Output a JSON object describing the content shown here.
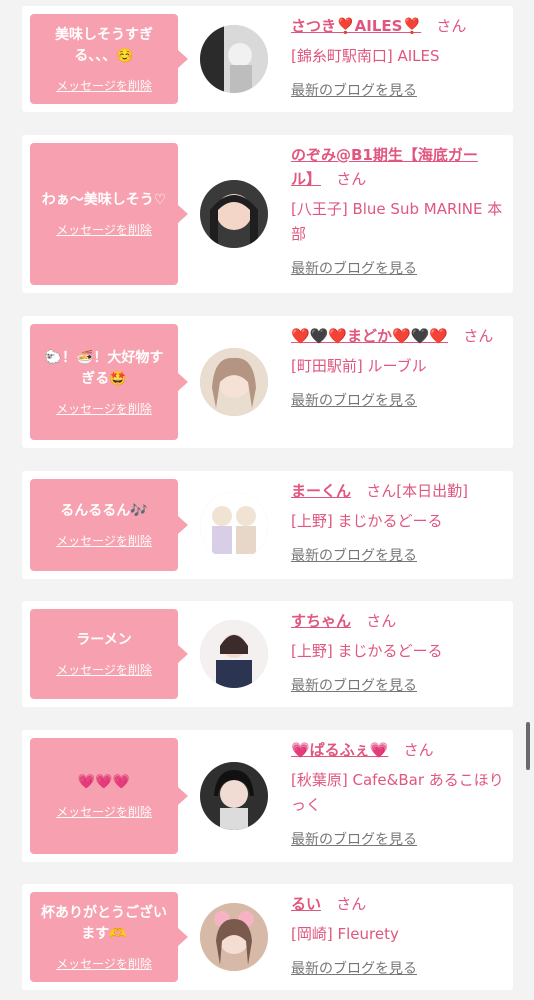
{
  "delete_label": "メッセージを削除",
  "blog_label": "最新のブログを見る",
  "san": "さん",
  "items": [
    {
      "message": "美味しそうすぎる、、、☺️",
      "name": "さつき❣️AILES❣️",
      "suffix": "",
      "shop": "[錦糸町駅南口] AILES"
    },
    {
      "message": "わぁ〜美味しそう♡",
      "name": "のぞみ@B1期生【海底ガール】",
      "suffix": "",
      "shop": "[八王子] Blue Sub MARINE 本部"
    },
    {
      "message": "🐑！🍜！大好物すぎる🤩",
      "name": "❤️🖤❤️まどか❤️🖤❤️",
      "suffix": "",
      "shop": "[町田駅前] ルーブル"
    },
    {
      "message": "るんるるん🎶",
      "name": "まーくん",
      "suffix": "[本日出勤]",
      "shop": "[上野] まじかるどーる"
    },
    {
      "message": "ラーメン",
      "name": "すちゃん",
      "suffix": "",
      "shop": "[上野] まじかるどーる"
    },
    {
      "message": "💗💗💗",
      "name": "💗ぱるふぇ💗",
      "suffix": "",
      "shop": "[秋葉原] Cafe&Bar あるこほりっく"
    },
    {
      "message": "杯ありがとうございます🫶",
      "name": "るい",
      "suffix": "",
      "shop": "[岡崎] Fleurety"
    }
  ],
  "colors": {
    "accent": "#e0567e",
    "bubble": "#f7a1b0",
    "background": "#f3f3f3"
  }
}
